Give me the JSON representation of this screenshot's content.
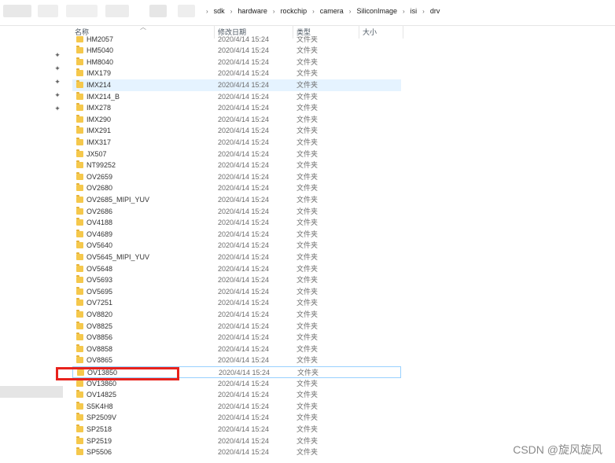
{
  "breadcrumb": [
    "sdk",
    "hardware",
    "rockchip",
    "camera",
    "SiliconImage",
    "isi",
    "drv"
  ],
  "columns": {
    "name": "名称",
    "modified": "修改日期",
    "type": "类型",
    "size": "大小"
  },
  "colors": {
    "selected_row": "#e5f3ff",
    "focus_border": "#99d1ff",
    "highlight_box": "#e8221c",
    "folder": "#f5c84c"
  },
  "files": [
    {
      "name": "HM2057",
      "date": "2020/4/14 15:24",
      "type": "文件夹"
    },
    {
      "name": "HM5040",
      "date": "2020/4/14 15:24",
      "type": "文件夹"
    },
    {
      "name": "HM8040",
      "date": "2020/4/14 15:24",
      "type": "文件夹"
    },
    {
      "name": "IMX179",
      "date": "2020/4/14 15:24",
      "type": "文件夹"
    },
    {
      "name": "IMX214",
      "date": "2020/4/14 15:24",
      "type": "文件夹"
    },
    {
      "name": "IMX214_B",
      "date": "2020/4/14 15:24",
      "type": "文件夹"
    },
    {
      "name": "IMX278",
      "date": "2020/4/14 15:24",
      "type": "文件夹"
    },
    {
      "name": "IMX290",
      "date": "2020/4/14 15:24",
      "type": "文件夹"
    },
    {
      "name": "IMX291",
      "date": "2020/4/14 15:24",
      "type": "文件夹"
    },
    {
      "name": "IMX317",
      "date": "2020/4/14 15:24",
      "type": "文件夹"
    },
    {
      "name": "JX507",
      "date": "2020/4/14 15:24",
      "type": "文件夹"
    },
    {
      "name": "NT99252",
      "date": "2020/4/14 15:24",
      "type": "文件夹"
    },
    {
      "name": "OV2659",
      "date": "2020/4/14 15:24",
      "type": "文件夹"
    },
    {
      "name": "OV2680",
      "date": "2020/4/14 15:24",
      "type": "文件夹"
    },
    {
      "name": "OV2685_MIPI_YUV",
      "date": "2020/4/14 15:24",
      "type": "文件夹"
    },
    {
      "name": "OV2686",
      "date": "2020/4/14 15:24",
      "type": "文件夹"
    },
    {
      "name": "OV4188",
      "date": "2020/4/14 15:24",
      "type": "文件夹"
    },
    {
      "name": "OV4689",
      "date": "2020/4/14 15:24",
      "type": "文件夹"
    },
    {
      "name": "OV5640",
      "date": "2020/4/14 15:24",
      "type": "文件夹"
    },
    {
      "name": "OV5645_MIPI_YUV",
      "date": "2020/4/14 15:24",
      "type": "文件夹"
    },
    {
      "name": "OV5648",
      "date": "2020/4/14 15:24",
      "type": "文件夹"
    },
    {
      "name": "OV5693",
      "date": "2020/4/14 15:24",
      "type": "文件夹"
    },
    {
      "name": "OV5695",
      "date": "2020/4/14 15:24",
      "type": "文件夹"
    },
    {
      "name": "OV7251",
      "date": "2020/4/14 15:24",
      "type": "文件夹"
    },
    {
      "name": "OV8820",
      "date": "2020/4/14 15:24",
      "type": "文件夹"
    },
    {
      "name": "OV8825",
      "date": "2020/4/14 15:24",
      "type": "文件夹"
    },
    {
      "name": "OV8856",
      "date": "2020/4/14 15:24",
      "type": "文件夹"
    },
    {
      "name": "OV8858",
      "date": "2020/4/14 15:24",
      "type": "文件夹"
    },
    {
      "name": "OV8865",
      "date": "2020/4/14 15:24",
      "type": "文件夹"
    },
    {
      "name": "OV13850",
      "date": "2020/4/14 15:24",
      "type": "文件夹"
    },
    {
      "name": "OV13860",
      "date": "2020/4/14 15:24",
      "type": "文件夹"
    },
    {
      "name": "OV14825",
      "date": "2020/4/14 15:24",
      "type": "文件夹"
    },
    {
      "name": "S5K4H8",
      "date": "2020/4/14 15:24",
      "type": "文件夹"
    },
    {
      "name": "SP2509V",
      "date": "2020/4/14 15:24",
      "type": "文件夹"
    },
    {
      "name": "SP2518",
      "date": "2020/4/14 15:24",
      "type": "文件夹"
    },
    {
      "name": "SP2519",
      "date": "2020/4/14 15:24",
      "type": "文件夹"
    },
    {
      "name": "SP5506",
      "date": "2020/4/14 15:24",
      "type": "文件夹"
    }
  ],
  "watermark": "CSDN @旋风旋风"
}
